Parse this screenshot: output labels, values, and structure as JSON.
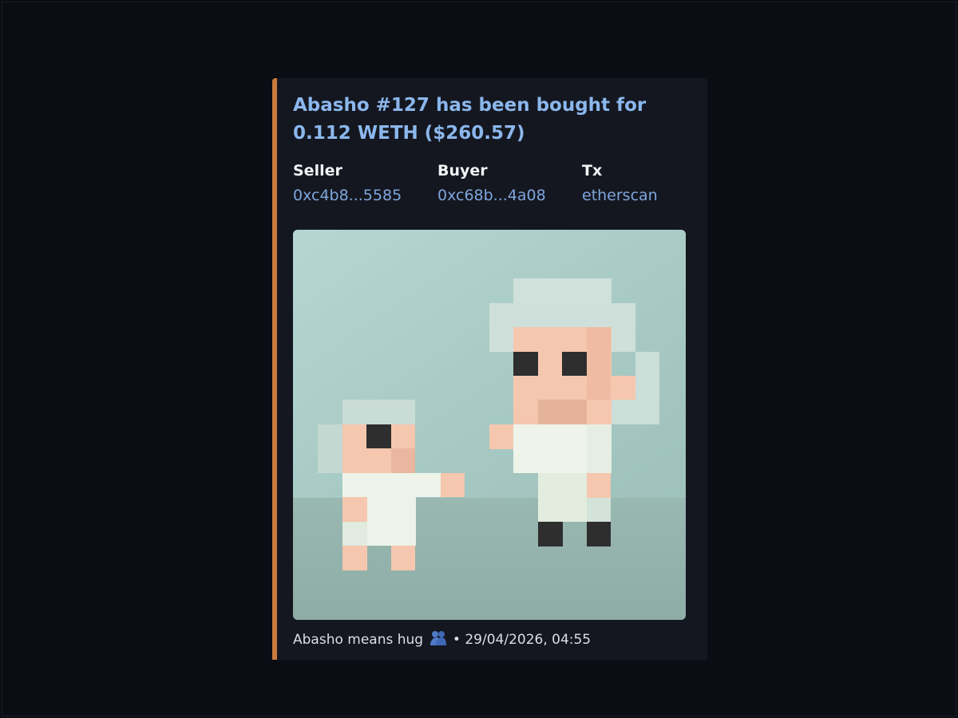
{
  "embed": {
    "accent_color": "#c97a3e",
    "title": "Abasho #127 has been bought for 0.112 WETH ($260.57)",
    "fields": [
      {
        "name": "Seller",
        "value": "0xc4b8...5585"
      },
      {
        "name": "Buyer",
        "value": "0xc68b...4a08"
      },
      {
        "name": "Tx",
        "value": "etherscan"
      }
    ],
    "footer": {
      "text": "Abasho means hug",
      "emoji": "people-hugging-emoji",
      "separator": "•",
      "timestamp": "29/04/2026, 04:55"
    }
  }
}
